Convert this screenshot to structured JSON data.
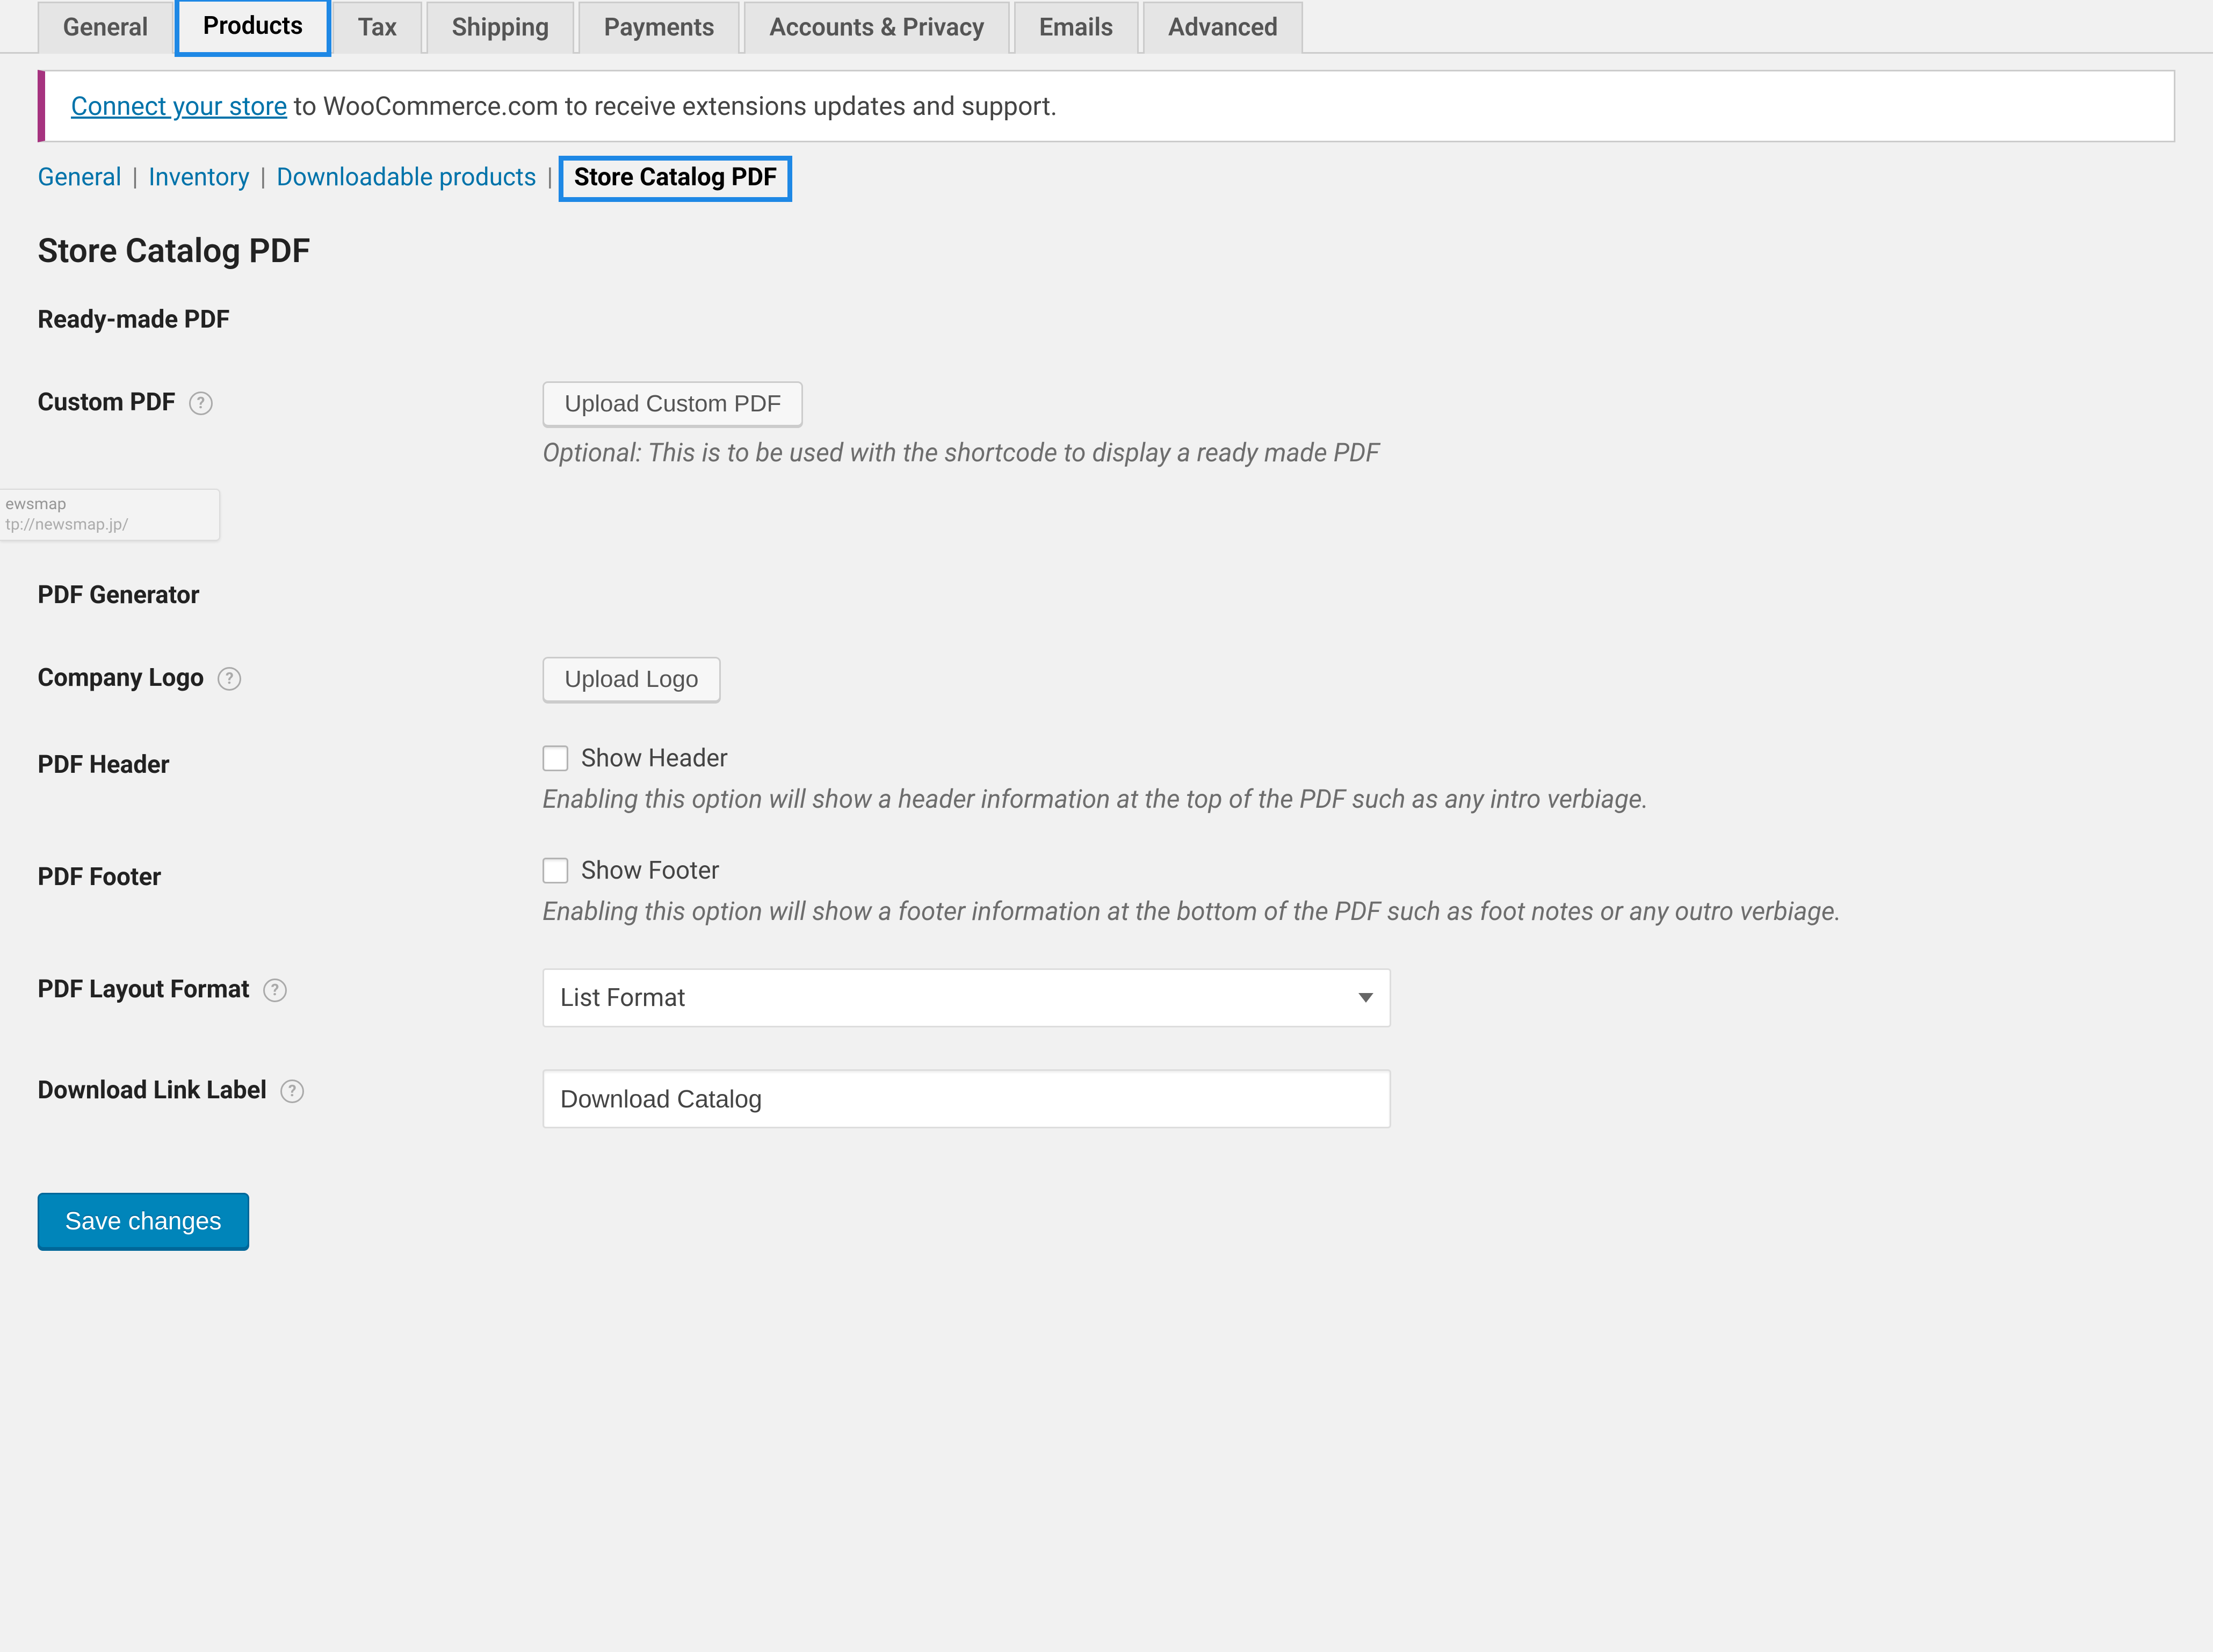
{
  "tabs": {
    "items": [
      {
        "label": "General",
        "active": false,
        "hilite": false
      },
      {
        "label": "Products",
        "active": true,
        "hilite": true
      },
      {
        "label": "Tax",
        "active": false,
        "hilite": false
      },
      {
        "label": "Shipping",
        "active": false,
        "hilite": false
      },
      {
        "label": "Payments",
        "active": false,
        "hilite": false
      },
      {
        "label": "Accounts & Privacy",
        "active": false,
        "hilite": false
      },
      {
        "label": "Emails",
        "active": false,
        "hilite": false
      },
      {
        "label": "Advanced",
        "active": false,
        "hilite": false
      }
    ]
  },
  "notice": {
    "link_text": "Connect your store",
    "tail": " to WooCommerce.com to receive extensions updates and support."
  },
  "subnav": {
    "items": [
      {
        "label": "General",
        "current": false
      },
      {
        "label": "Inventory",
        "current": false
      },
      {
        "label": "Downloadable products",
        "current": false
      },
      {
        "label": "Store Catalog PDF",
        "current": true
      }
    ]
  },
  "headings": {
    "page_title": "Store Catalog PDF",
    "ready_made": "Ready-made PDF",
    "pdf_generator": "PDF Generator"
  },
  "fields": {
    "custom_pdf": {
      "label": "Custom PDF",
      "button": "Upload Custom PDF",
      "desc": "Optional: This is to be used with the shortcode to display a ready made PDF"
    },
    "company_logo": {
      "label": "Company Logo",
      "button": "Upload Logo"
    },
    "pdf_header": {
      "label": "PDF Header",
      "checkbox_label": "Show Header",
      "desc": "Enabling this option will show a header information at the top of the PDF such as any intro verbiage."
    },
    "pdf_footer": {
      "label": "PDF Footer",
      "checkbox_label": "Show Footer",
      "desc": "Enabling this option will show a footer information at the bottom of the PDF such as foot notes or any outro verbiage."
    },
    "layout_format": {
      "label": "PDF Layout Format",
      "selected": "List Format"
    },
    "download_link_label": {
      "label": "Download Link Label",
      "value": "Download Catalog"
    }
  },
  "submit": {
    "label": "Save changes"
  },
  "ghost_tab": {
    "line1": "ewsmap",
    "line2": "tp://newsmap.jp/"
  }
}
